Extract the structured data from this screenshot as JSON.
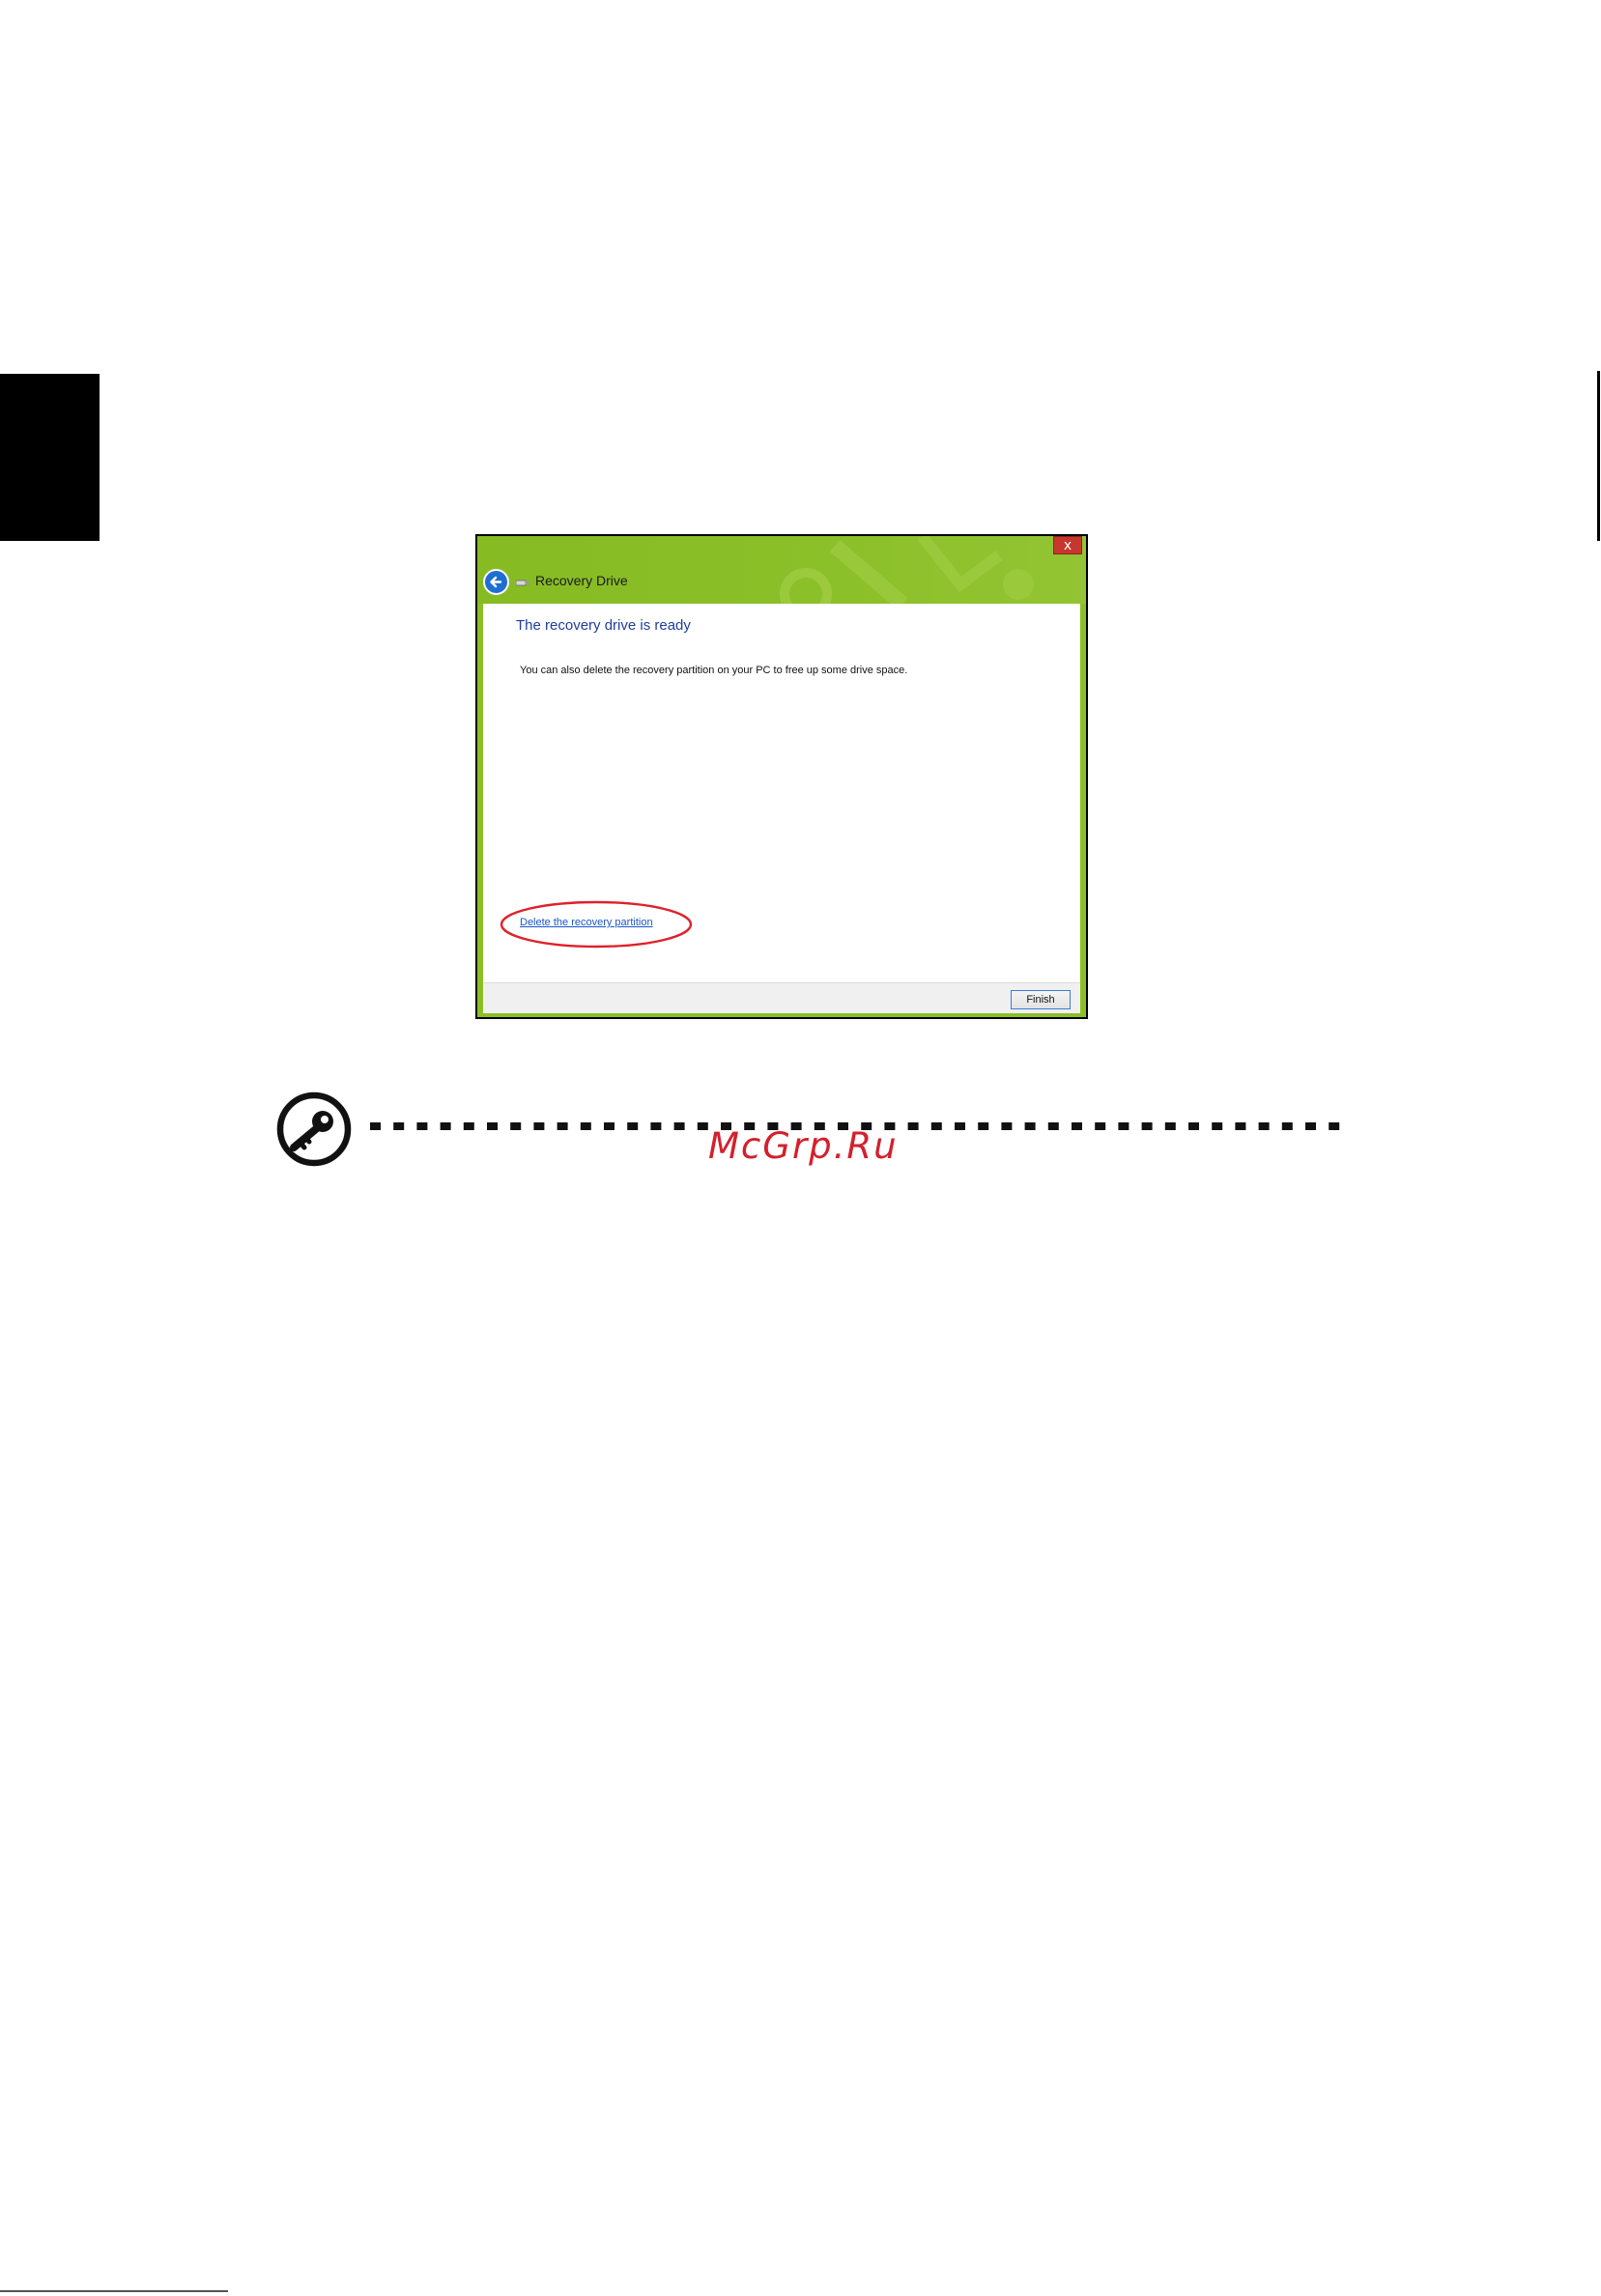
{
  "window": {
    "title": "Recovery Drive",
    "close_glyph": "x",
    "heading": "The recovery drive is ready",
    "body_text": "You can also delete the recovery partition on your PC to free up some drive space.",
    "delete_link": "Delete the recovery partition",
    "finish_button": "Finish",
    "accent_color": "#8cbf26",
    "highlight_color": "#e0202a"
  },
  "note": {
    "icon": "key-in-circle-icon"
  },
  "watermark": {
    "text": "McGrp.Ru",
    "color": "#d4202c"
  }
}
